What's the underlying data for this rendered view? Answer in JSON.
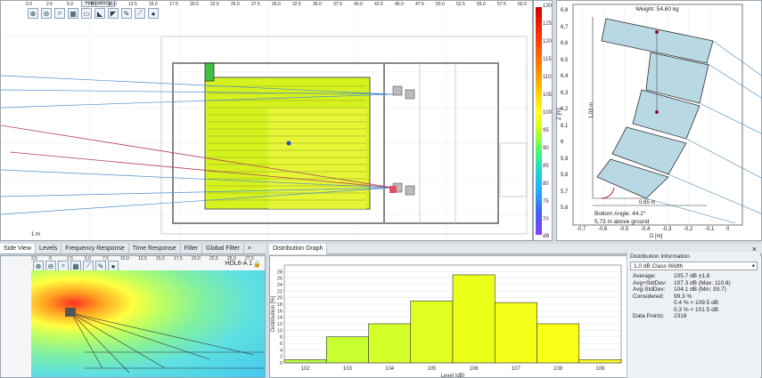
{
  "plan": {
    "tab_label": "Frequency",
    "ruler_ticks": [
      "0.0",
      "2.5",
      "5.0",
      "7.5",
      "10.0",
      "12.5",
      "15.0",
      "17.5",
      "20.0",
      "22.5",
      "25.0",
      "27.5",
      "30.0",
      "32.5",
      "35.0",
      "37.5",
      "40.0",
      "42.5",
      "45.0",
      "47.5",
      "50.0",
      "52.5",
      "55.0",
      "57.5",
      "60.0"
    ],
    "scale_label": "1 m"
  },
  "colorbar": {
    "ticks": [
      "130",
      "125",
      "120",
      "115",
      "110",
      "105",
      "100",
      "95",
      "90",
      "85",
      "80",
      "75",
      "70"
    ],
    "unit": "dB"
  },
  "sideview": {
    "weight": "Weight: 54,60 kg",
    "bottom_angle": "Bottom Angle: 44.2°",
    "above_ground": "5,73 m above ground",
    "height_dim": "1,03 m",
    "width_dim": "0,65 m",
    "y_label": "Z [m]",
    "x_label": "D [m]",
    "y_ticks": [
      "6,8",
      "6,7",
      "6,6",
      "6,5",
      "6,4",
      "6,3",
      "6,2",
      "6,1",
      "6",
      "5,9",
      "5,8",
      "5,7",
      "5,6"
    ],
    "x_ticks": [
      "-0,7",
      "-0,6",
      "-0,5",
      "-0,4",
      "-0,3",
      "-0,2",
      "-0,1",
      "0"
    ]
  },
  "bottom_left": {
    "tabs": [
      "Side View",
      "Levels",
      "Frequency Response",
      "Time Response",
      "Filter",
      "Global Filter"
    ],
    "close": "×",
    "device_label": "HDL6-A 1",
    "ruler_ticks": [
      "2,5",
      "0",
      "2,5",
      "5,0",
      "7,5",
      "10,0",
      "12,5",
      "15,0",
      "17,5",
      "20,0",
      "22,5",
      "25,0",
      "27,5"
    ]
  },
  "distribution": {
    "tab": "Distribution Graph",
    "close": "×",
    "ylabel": "Distribution [%]",
    "xlabel": "Level [dB]"
  },
  "dist_info": {
    "title": "Distribution Information",
    "class_width": "1,0 dB Class Width",
    "rows": [
      {
        "k": "Average:",
        "v": "105.7 dB ±1,6"
      },
      {
        "k": "Avg+StdDev:",
        "v": "107.3 dB (Max: 110.8)"
      },
      {
        "k": "Avg-StdDev:",
        "v": "104.1 dB (Min: 93.7)"
      },
      {
        "k": "Considered:",
        "v": "99.3 %"
      },
      {
        "k": "",
        "v": "0.4 % > 109.5 dB"
      },
      {
        "k": "",
        "v": "0.3 % < 101.5 dB"
      },
      {
        "k": "Data Points:",
        "v": "2318"
      }
    ]
  },
  "chart_data": {
    "type": "bar",
    "categories": [
      "102",
      "103",
      "104",
      "105",
      "106",
      "107",
      "108",
      "109"
    ],
    "values": [
      1.0,
      8.0,
      12.0,
      19.0,
      27.0,
      18.5,
      12.0,
      1.0
    ],
    "colors": [
      "#b8ff40",
      "#c8ff30",
      "#d4ff28",
      "#e0ff20",
      "#ecff18",
      "#f4ff18",
      "#fbff18",
      "#ffff20"
    ],
    "xlabel": "Level [dB]",
    "ylabel": "Distribution [%]",
    "ylim": [
      0,
      30
    ],
    "yticks": [
      0,
      2,
      4,
      6,
      8,
      10,
      12,
      14,
      16,
      18,
      20,
      22,
      24,
      26,
      28
    ],
    "grid": true
  }
}
